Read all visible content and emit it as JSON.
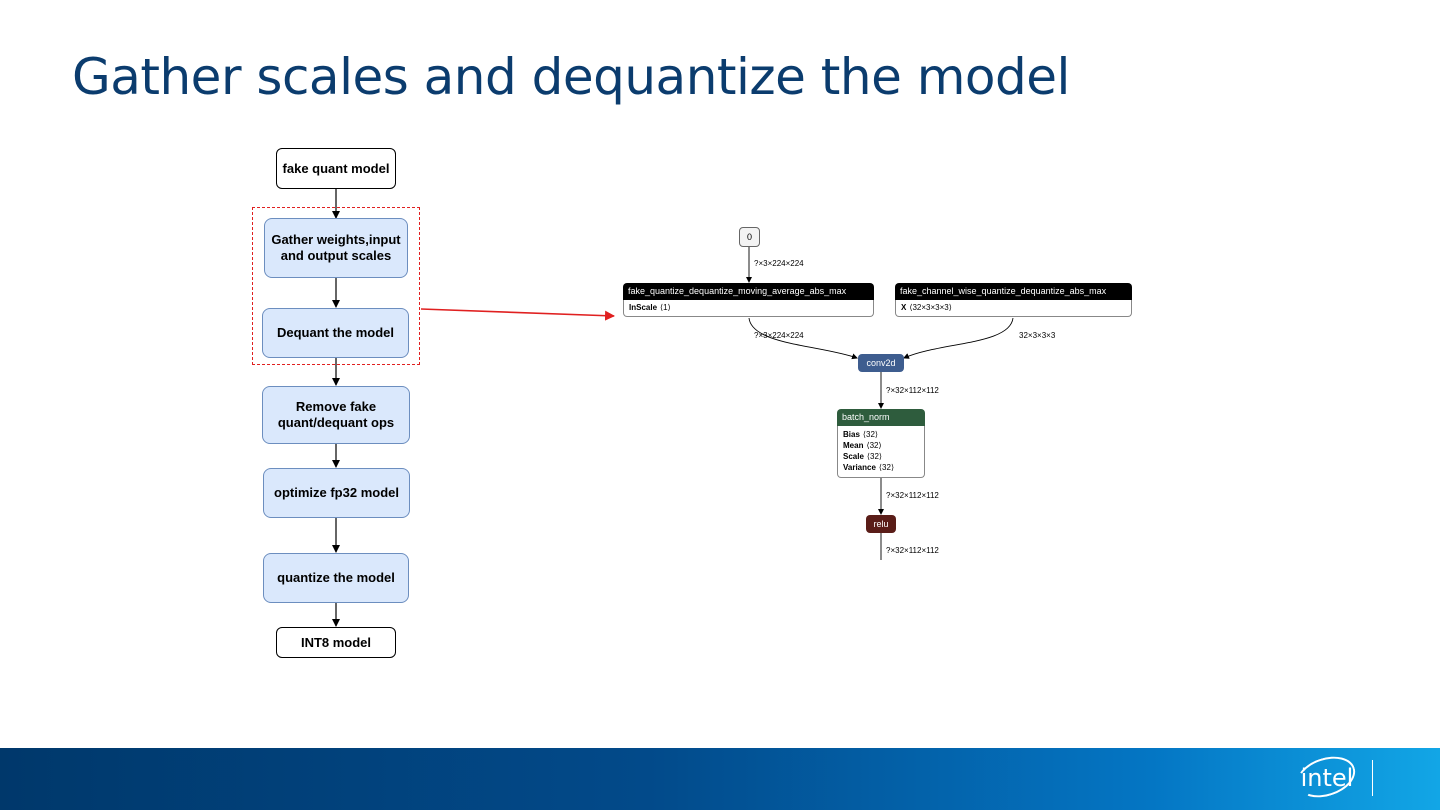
{
  "slide": {
    "title": "Gather scales and dequantize the model"
  },
  "flowchart": {
    "fake_quant_model": "fake quant model",
    "gather_scales": "Gather weights,input\nand output scales",
    "dequant_model": "Dequant the model",
    "remove_ops": "Remove fake\nquant/dequant ops",
    "optimize_fp32": "optimize fp32 model",
    "quantize_model": "quantize the model",
    "int8_model": "INT8 model"
  },
  "graph": {
    "input_node": "0",
    "edge_input": "?×3×224×224",
    "fq_node": {
      "name": "fake_quantize_dequantize_moving_average_abs_max",
      "attr_key": "InScale",
      "attr_val": "⟨1⟩"
    },
    "fc_node": {
      "name": "fake_channel_wise_quantize_dequantize_abs_max",
      "attr_key": "X",
      "attr_val": "⟨32×3×3×3⟩"
    },
    "edge_fq_out": "?×3×224×224",
    "edge_fc_out": "32×3×3×3",
    "conv_node": "conv2d",
    "edge_conv_out": "?×32×112×112",
    "bn_node": {
      "name": "batch_norm",
      "attrs": [
        {
          "key": "Bias",
          "val": "⟨32⟩"
        },
        {
          "key": "Mean",
          "val": "⟨32⟩"
        },
        {
          "key": "Scale",
          "val": "⟨32⟩"
        },
        {
          "key": "Variance",
          "val": "⟨32⟩"
        }
      ]
    },
    "edge_bn_out": "?×32×112×112",
    "relu_node": "relu",
    "edge_relu_out": "?×32×112×112"
  },
  "colors": {
    "title": "#0b3c6e",
    "flow_blue_fill": "#dae8fc",
    "flow_blue_border": "#6c8ebf",
    "highlight_red": "#e02020",
    "conv_header": "#3e5d8f",
    "bn_header": "#2e5c3d",
    "relu_header": "#5a1d18",
    "quant_header": "#000000"
  },
  "footer": {
    "logo": "intel"
  }
}
